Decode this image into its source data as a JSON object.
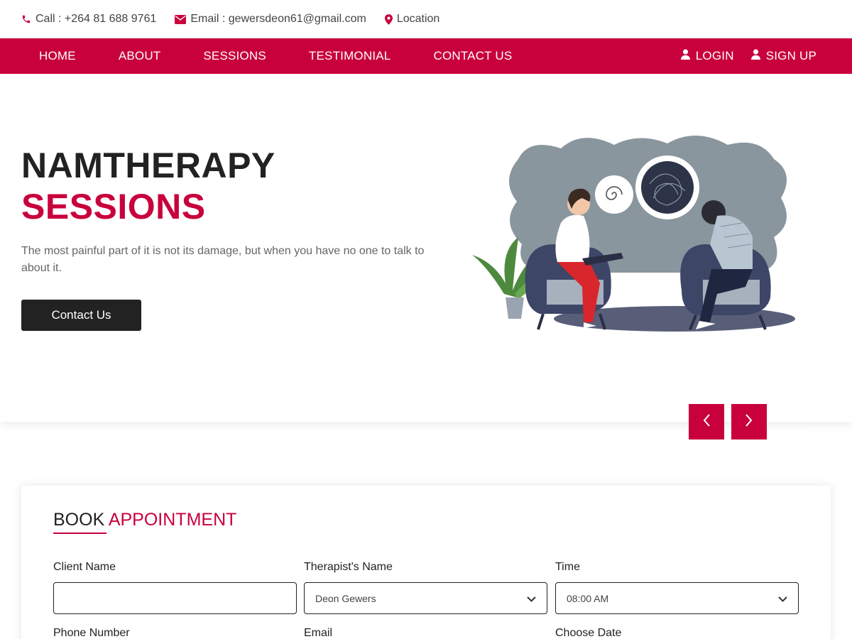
{
  "topbar": {
    "call": "Call : +264 81 688 9761",
    "email": "Email : gewersdeon61@gmail.com",
    "location": "Location"
  },
  "nav": {
    "links": [
      "HOME",
      "ABOUT",
      "SESSIONS",
      "TESTIMONIAL",
      "CONTACT US"
    ],
    "login": "LOGIN",
    "signup": "SIGN UP"
  },
  "hero": {
    "title_line1": "NAMTHERAPY",
    "title_line2": "SESSIONS",
    "lead": "The most painful part of it is not its damage, but when you have no one to talk to about it.",
    "cta": "Contact Us"
  },
  "booking": {
    "title_part1": "BOOK",
    "title_part2": "APPOINTMENT",
    "fields": {
      "client_name": {
        "label": "Client Name",
        "value": ""
      },
      "therapist": {
        "label": "Therapist's Name",
        "value": "Deon Gewers"
      },
      "time": {
        "label": "Time",
        "value": "08:00 AM"
      },
      "phone": {
        "label": "Phone Number"
      },
      "email": {
        "label": "Email"
      },
      "date": {
        "label": "Choose Date"
      }
    }
  },
  "colors": {
    "accent": "#c8003c",
    "dark": "#222222",
    "teal": "#4fc7c0"
  },
  "icons": [
    "phone-icon",
    "envelope-icon",
    "map-marker-icon",
    "user-icon",
    "chevron-left-icon",
    "chevron-right-icon",
    "chevron-down-icon"
  ]
}
